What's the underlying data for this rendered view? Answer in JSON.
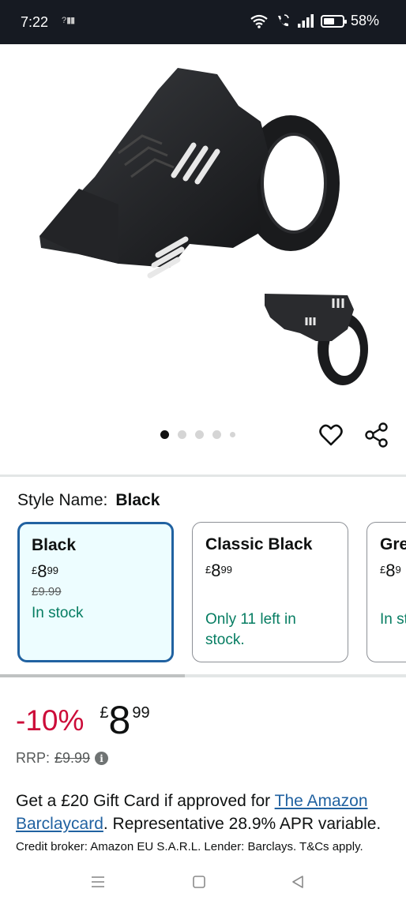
{
  "status_bar": {
    "time": "7:22",
    "small_signal": "?",
    "battery_percent": "58%",
    "battery_level": 0.58,
    "icons": [
      "wifi-icon",
      "wifi-calling-icon",
      "cell-signal-icon",
      "battery-icon"
    ]
  },
  "gallery": {
    "dot_count": 5,
    "active_index": 0,
    "icons": [
      "heart-icon",
      "share-icon"
    ]
  },
  "style": {
    "label": "Style Name:",
    "value": "Black"
  },
  "variants": [
    {
      "name": "Black",
      "currency": "£",
      "price_main": "8",
      "price_frac": "99",
      "was_price": "£9.99",
      "stock": "In stock",
      "selected": true
    },
    {
      "name": "Classic Black",
      "currency": "£",
      "price_main": "8",
      "price_frac": "99",
      "was_price": "",
      "stock": "Only 11 left in stock.",
      "selected": false
    },
    {
      "name": "Gre",
      "currency": "£",
      "price_main": "8",
      "price_frac": "9",
      "was_price": "",
      "stock": "In st",
      "selected": false
    }
  ],
  "price": {
    "discount": "-10%",
    "currency": "£",
    "main": "8",
    "fraction": "99",
    "rrp_label": "RRP:",
    "rrp_value": "£9.99"
  },
  "offer": {
    "text_before": "Get a £20 Gift Card if approved for ",
    "link_text": "The Amazon Barclaycard",
    "text_after": ". Representative 28.9% APR variable.",
    "broker": "Credit broker: Amazon EU S.A.R.L. Lender: Barclays. T&Cs apply."
  },
  "colors": {
    "status_bar_bg": "#161a22",
    "discount_red": "#cc0c39",
    "in_stock_green": "#067d62",
    "link_blue": "#2162a1",
    "selected_card_bg": "#edfdff"
  },
  "navbar": {
    "icons": [
      "menu-icon",
      "home-icon",
      "back-icon"
    ]
  }
}
